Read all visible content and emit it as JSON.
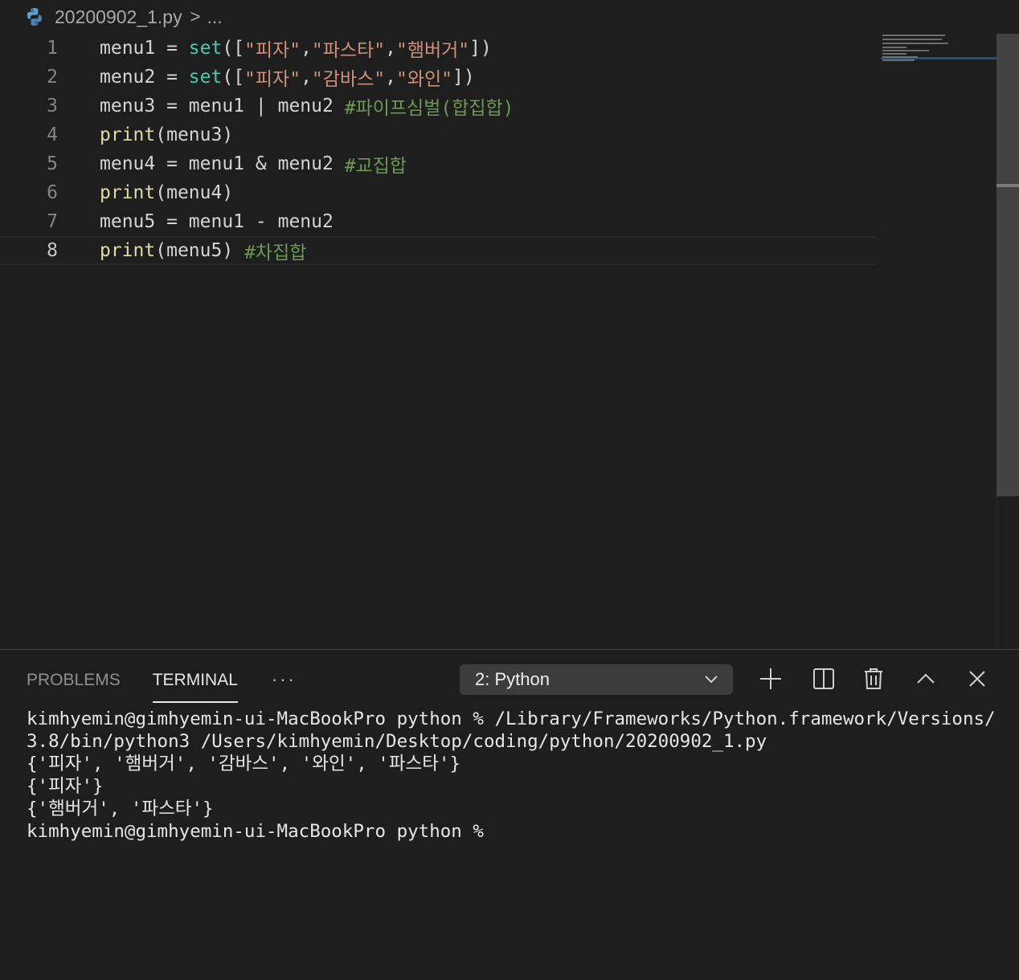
{
  "breadcrumb": {
    "file_name": "20200902_1.py",
    "separator": ">",
    "ellipsis": "..."
  },
  "editor": {
    "current_line": 8,
    "lines": [
      {
        "num": "1",
        "tokens": [
          {
            "t": "menu1",
            "c": "id"
          },
          {
            "t": " = ",
            "c": "op"
          },
          {
            "t": "set",
            "c": "builtin"
          },
          {
            "t": "([",
            "c": "op"
          },
          {
            "t": "\"피자\"",
            "c": "str"
          },
          {
            "t": ",",
            "c": "op"
          },
          {
            "t": "\"파스타\"",
            "c": "str"
          },
          {
            "t": ",",
            "c": "op"
          },
          {
            "t": "\"햄버거\"",
            "c": "str"
          },
          {
            "t": "])",
            "c": "op"
          }
        ]
      },
      {
        "num": "2",
        "tokens": [
          {
            "t": "menu2",
            "c": "id"
          },
          {
            "t": " = ",
            "c": "op"
          },
          {
            "t": "set",
            "c": "builtin"
          },
          {
            "t": "([",
            "c": "op"
          },
          {
            "t": "\"피자\"",
            "c": "str"
          },
          {
            "t": ",",
            "c": "op"
          },
          {
            "t": "\"감바스\"",
            "c": "str"
          },
          {
            "t": ",",
            "c": "op"
          },
          {
            "t": "\"와인\"",
            "c": "str"
          },
          {
            "t": "])",
            "c": "op"
          }
        ]
      },
      {
        "num": "3",
        "tokens": [
          {
            "t": "menu3",
            "c": "id"
          },
          {
            "t": " = ",
            "c": "op"
          },
          {
            "t": "menu1",
            "c": "id"
          },
          {
            "t": " | ",
            "c": "op"
          },
          {
            "t": "menu2",
            "c": "id"
          },
          {
            "t": " ",
            "c": "op"
          },
          {
            "t": "#파이프심벌(합집합)",
            "c": "comment"
          }
        ]
      },
      {
        "num": "4",
        "tokens": [
          {
            "t": "print",
            "c": "fn"
          },
          {
            "t": "(",
            "c": "op"
          },
          {
            "t": "menu3",
            "c": "id"
          },
          {
            "t": ")",
            "c": "op"
          }
        ]
      },
      {
        "num": "5",
        "tokens": [
          {
            "t": "menu4",
            "c": "id"
          },
          {
            "t": " = ",
            "c": "op"
          },
          {
            "t": "menu1",
            "c": "id"
          },
          {
            "t": " & ",
            "c": "op"
          },
          {
            "t": "menu2",
            "c": "id"
          },
          {
            "t": " ",
            "c": "op"
          },
          {
            "t": "#교집합",
            "c": "comment"
          }
        ]
      },
      {
        "num": "6",
        "tokens": [
          {
            "t": "print",
            "c": "fn"
          },
          {
            "t": "(",
            "c": "op"
          },
          {
            "t": "menu4",
            "c": "id"
          },
          {
            "t": ")",
            "c": "op"
          }
        ]
      },
      {
        "num": "7",
        "tokens": [
          {
            "t": "menu5",
            "c": "id"
          },
          {
            "t": " = ",
            "c": "op"
          },
          {
            "t": "menu1",
            "c": "id"
          },
          {
            "t": " - ",
            "c": "op"
          },
          {
            "t": "menu2",
            "c": "id"
          }
        ]
      },
      {
        "num": "8",
        "tokens": [
          {
            "t": "print",
            "c": "fn"
          },
          {
            "t": "(",
            "c": "op"
          },
          {
            "t": "menu5",
            "c": "id"
          },
          {
            "t": ")",
            "c": "op"
          },
          {
            "t": " ",
            "c": "op"
          },
          {
            "t": "#차집합",
            "c": "comment"
          }
        ]
      }
    ]
  },
  "panel": {
    "tabs": [
      {
        "label": "PROBLEMS",
        "active": false
      },
      {
        "label": "TERMINAL",
        "active": true
      }
    ],
    "more_label": "···",
    "terminal_selector": "2: Python",
    "actions": [
      "plus-icon",
      "split-icon",
      "trash-icon",
      "chevron-up-icon",
      "close-icon"
    ]
  },
  "terminal": {
    "lines": [
      "kimhyemin@gimhyemin-ui-MacBookPro python % /Library/Frameworks/Python.framework/Versions/3.8/bin/python3 /Users/kimhyemin/Desktop/coding/python/20200902_1.py",
      "{'피자', '햄버거', '감바스', '와인', '파스타'}",
      "{'피자'}",
      "{'햄버거', '파스타'}",
      "kimhyemin@gimhyemin-ui-MacBookPro python % "
    ]
  },
  "colors": {
    "background": "#1e1e1e",
    "string": "#ce9178",
    "comment": "#6a9955",
    "builtin": "#4ec9b0",
    "function": "#dcdcaa"
  }
}
